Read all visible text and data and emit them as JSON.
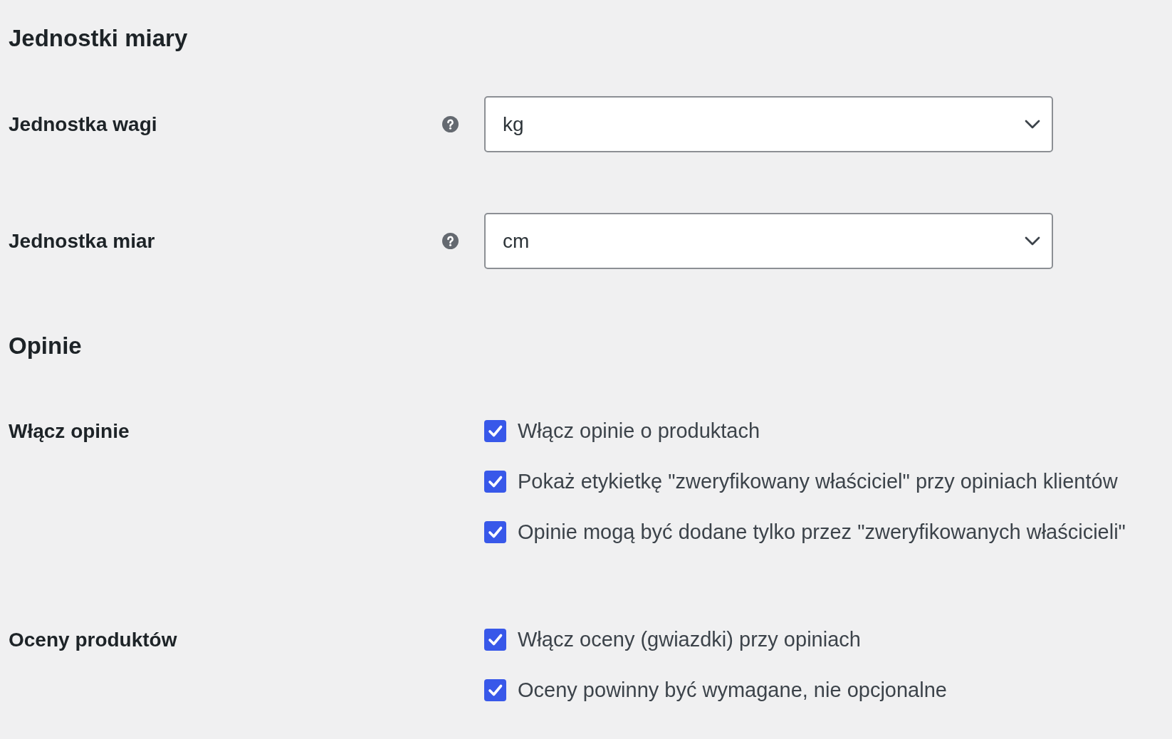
{
  "sections": [
    {
      "title": "Jednostki miary",
      "fields": [
        {
          "kind": "select",
          "label": "Jednostka wagi",
          "help": true,
          "value": "kg"
        },
        {
          "kind": "select",
          "label": "Jednostka miar",
          "help": true,
          "value": "cm"
        }
      ]
    },
    {
      "title": "Opinie",
      "fields": [
        {
          "kind": "checkboxes",
          "label": "Włącz opinie",
          "options": [
            {
              "label": "Włącz opinie o produktach",
              "checked": true
            },
            {
              "label": "Pokaż etykietkę \"zweryfikowany właściciel\" przy opiniach klientów",
              "checked": true
            },
            {
              "label": "Opinie mogą być dodane tylko przez \"zweryfikowanych właścicieli\"",
              "checked": true
            }
          ]
        },
        {
          "kind": "checkboxes",
          "label": "Oceny produktów",
          "options": [
            {
              "label": "Włącz oceny (gwiazdki) przy opiniach",
              "checked": true
            },
            {
              "label": "Oceny powinny być wymagane, nie opcjonalne",
              "checked": true
            }
          ]
        }
      ]
    }
  ]
}
